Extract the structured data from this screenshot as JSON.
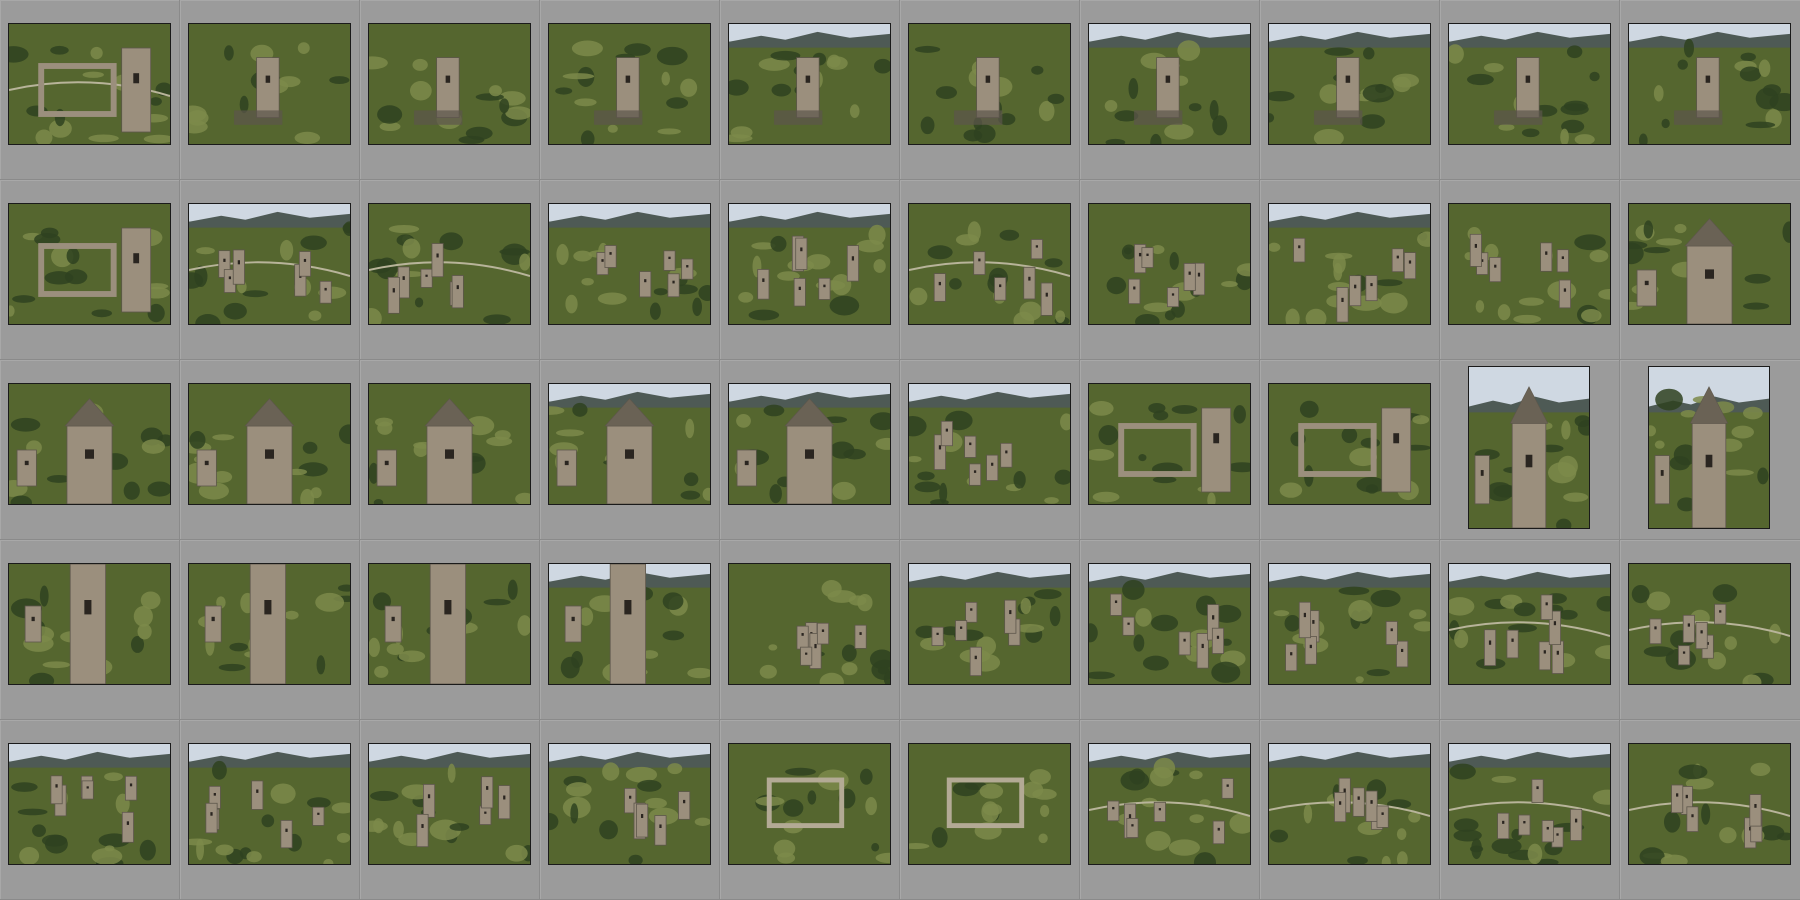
{
  "grid": {
    "columns": 10,
    "rows": 5,
    "background": "#9a9a9a",
    "thumbnails": [
      {
        "orientation": "landscape",
        "sky": false,
        "tower": "ruin",
        "scene": "valley"
      },
      {
        "orientation": "landscape",
        "sky": false,
        "tower": "single",
        "scene": "slope"
      },
      {
        "orientation": "landscape",
        "sky": false,
        "tower": "single",
        "scene": "slope"
      },
      {
        "orientation": "landscape",
        "sky": false,
        "tower": "single",
        "scene": "slope"
      },
      {
        "orientation": "landscape",
        "sky": true,
        "tower": "single",
        "scene": "slope"
      },
      {
        "orientation": "landscape",
        "sky": false,
        "tower": "single",
        "scene": "slope"
      },
      {
        "orientation": "landscape",
        "sky": true,
        "tower": "single",
        "scene": "slope"
      },
      {
        "orientation": "landscape",
        "sky": true,
        "tower": "single",
        "scene": "slope"
      },
      {
        "orientation": "landscape",
        "sky": true,
        "tower": "single",
        "scene": "slope"
      },
      {
        "orientation": "landscape",
        "sky": true,
        "tower": "single",
        "scene": "slope"
      },
      {
        "orientation": "landscape",
        "sky": false,
        "tower": "ruin",
        "scene": "closeup"
      },
      {
        "orientation": "landscape",
        "sky": true,
        "tower": "village",
        "scene": "valley"
      },
      {
        "orientation": "landscape",
        "sky": false,
        "tower": "village",
        "scene": "valley"
      },
      {
        "orientation": "landscape",
        "sky": true,
        "tower": "village",
        "scene": "slope"
      },
      {
        "orientation": "landscape",
        "sky": true,
        "tower": "village",
        "scene": "slope"
      },
      {
        "orientation": "landscape",
        "sky": false,
        "tower": "village",
        "scene": "valley"
      },
      {
        "orientation": "landscape",
        "sky": false,
        "tower": "village",
        "scene": "slope"
      },
      {
        "orientation": "landscape",
        "sky": true,
        "tower": "village",
        "scene": "slope"
      },
      {
        "orientation": "landscape",
        "sky": false,
        "tower": "village",
        "scene": "slope"
      },
      {
        "orientation": "landscape",
        "sky": false,
        "tower": "pyramid",
        "scene": "slope"
      },
      {
        "orientation": "landscape",
        "sky": false,
        "tower": "pyramid",
        "scene": "slope"
      },
      {
        "orientation": "landscape",
        "sky": false,
        "tower": "pyramid",
        "scene": "slope"
      },
      {
        "orientation": "landscape",
        "sky": false,
        "tower": "pyramid",
        "scene": "slope"
      },
      {
        "orientation": "landscape",
        "sky": true,
        "tower": "pyramid",
        "scene": "slope"
      },
      {
        "orientation": "landscape",
        "sky": true,
        "tower": "pyramid",
        "scene": "slope"
      },
      {
        "orientation": "landscape",
        "sky": true,
        "tower": "village",
        "scene": "slope"
      },
      {
        "orientation": "landscape",
        "sky": false,
        "tower": "ruin",
        "scene": "slope"
      },
      {
        "orientation": "landscape",
        "sky": false,
        "tower": "ruin",
        "scene": "closeup"
      },
      {
        "orientation": "portrait",
        "sky": true,
        "tower": "pyramid",
        "scene": "slope"
      },
      {
        "orientation": "portrait",
        "sky": true,
        "tower": "pyramid",
        "scene": "slope"
      },
      {
        "orientation": "landscape",
        "sky": false,
        "tower": "tall",
        "scene": "slope"
      },
      {
        "orientation": "landscape",
        "sky": false,
        "tower": "tall",
        "scene": "slope"
      },
      {
        "orientation": "landscape",
        "sky": false,
        "tower": "tall",
        "scene": "slope"
      },
      {
        "orientation": "landscape",
        "sky": true,
        "tower": "tall",
        "scene": "slope"
      },
      {
        "orientation": "landscape",
        "sky": false,
        "tower": "village",
        "scene": "slope"
      },
      {
        "orientation": "landscape",
        "sky": true,
        "tower": "village",
        "scene": "slope"
      },
      {
        "orientation": "landscape",
        "sky": true,
        "tower": "village",
        "scene": "slope"
      },
      {
        "orientation": "landscape",
        "sky": true,
        "tower": "village",
        "scene": "slope"
      },
      {
        "orientation": "landscape",
        "sky": true,
        "tower": "village",
        "scene": "valley"
      },
      {
        "orientation": "landscape",
        "sky": false,
        "tower": "village",
        "scene": "valley"
      },
      {
        "orientation": "landscape",
        "sky": true,
        "tower": "village",
        "scene": "slope"
      },
      {
        "orientation": "landscape",
        "sky": true,
        "tower": "village",
        "scene": "slope"
      },
      {
        "orientation": "landscape",
        "sky": true,
        "tower": "village",
        "scene": "slope"
      },
      {
        "orientation": "landscape",
        "sky": true,
        "tower": "village",
        "scene": "slope"
      },
      {
        "orientation": "landscape",
        "sky": false,
        "tower": "foundation",
        "scene": "closeup"
      },
      {
        "orientation": "landscape",
        "sky": false,
        "tower": "foundation",
        "scene": "closeup"
      },
      {
        "orientation": "landscape",
        "sky": true,
        "tower": "village",
        "scene": "valley"
      },
      {
        "orientation": "landscape",
        "sky": true,
        "tower": "village",
        "scene": "valley"
      },
      {
        "orientation": "landscape",
        "sky": true,
        "tower": "village",
        "scene": "valley"
      },
      {
        "orientation": "landscape",
        "sky": false,
        "tower": "village",
        "scene": "valley"
      }
    ]
  }
}
